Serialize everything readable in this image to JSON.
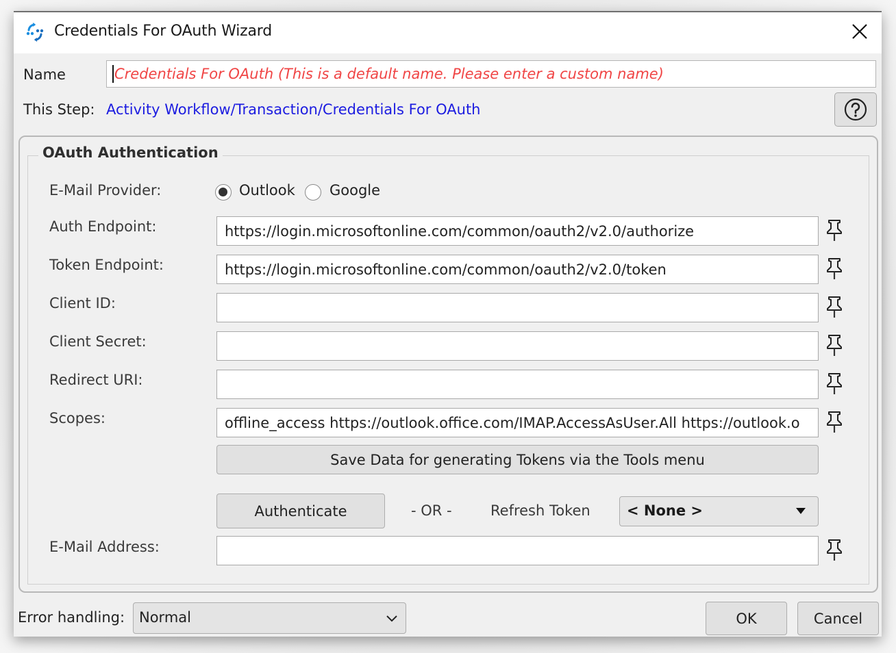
{
  "window": {
    "title": "Credentials For OAuth Wizard",
    "icon": "workflow-arrows-icon",
    "close_icon": "close-icon"
  },
  "header": {
    "name_label": "Name",
    "name_value": "Credentials For OAuth  (This is a default name. Please enter a custom name)",
    "this_step_label": "This Step:",
    "this_step_path": "Activity Workflow/Transaction/Credentials For OAuth",
    "help_icon": "help-icon"
  },
  "oauth": {
    "group_title": "OAuth Authentication",
    "provider_label": "E-Mail Provider:",
    "providers": [
      {
        "label": "Outlook",
        "selected": true
      },
      {
        "label": "Google",
        "selected": false
      }
    ],
    "fields": [
      {
        "label": "Auth Endpoint:",
        "value": "https://login.microsoftonline.com/common/oauth2/v2.0/authorize"
      },
      {
        "label": "Token Endpoint:",
        "value": "https://login.microsoftonline.com/common/oauth2/v2.0/token"
      },
      {
        "label": "Client ID:",
        "value": ""
      },
      {
        "label": "Client Secret:",
        "value": ""
      },
      {
        "label": "Redirect URI:",
        "value": ""
      },
      {
        "label": "Scopes:",
        "value": "offline_access https://outlook.office.com/IMAP.AccessAsUser.All https://outlook.o"
      }
    ],
    "save_button": "Save Data for generating Tokens via the Tools menu",
    "authenticate_button": "Authenticate",
    "or_text": "- OR -",
    "refresh_token_label": "Refresh Token",
    "refresh_token_value": "< None >",
    "email_label": "E-Mail Address:",
    "email_value": ""
  },
  "footer": {
    "error_handling_label": "Error handling:",
    "error_handling_value": "Normal",
    "ok_button": "OK",
    "cancel_button": "Cancel"
  }
}
